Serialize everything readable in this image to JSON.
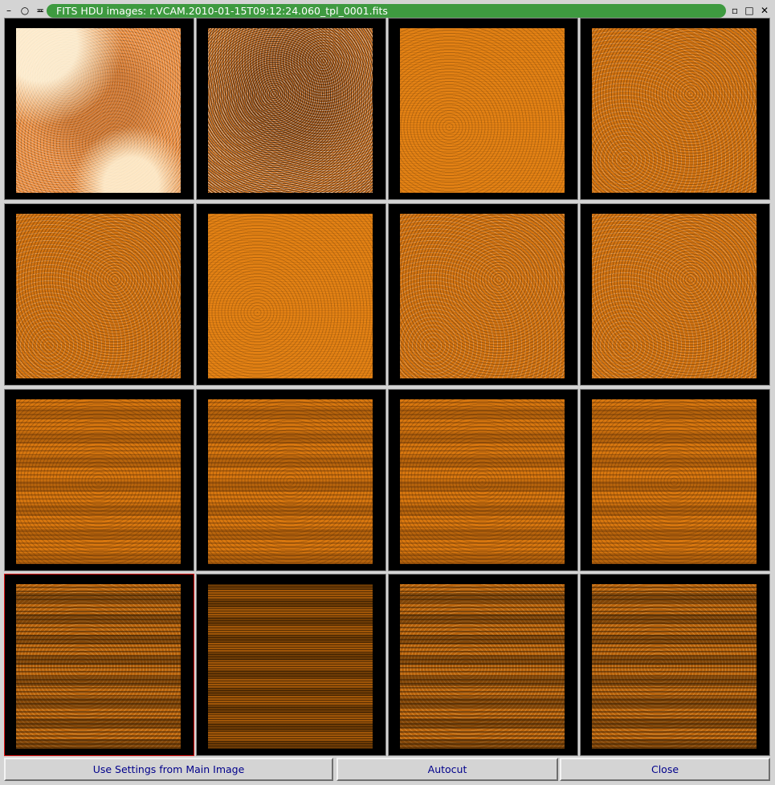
{
  "window": {
    "title": "FITS HDU images: r.VCAM.2010-01-15T09:12:24.060_tpl_0001.fits",
    "controls": {
      "menu_glyph": "–",
      "pin_glyph": "○",
      "shade_glyph": "≖",
      "minimize_glyph": "▫",
      "maximize_glyph": "□",
      "close_glyph": "✕"
    },
    "title_color": "#3e9a40"
  },
  "grid": {
    "columns": 4,
    "rows": 4,
    "selected_index": 12,
    "selected_border_color": "#e01818",
    "image_color": "#e07a10"
  },
  "buttons": {
    "use_settings": "Use Settings from Main Image",
    "autocut": "Autocut",
    "close": "Close"
  }
}
